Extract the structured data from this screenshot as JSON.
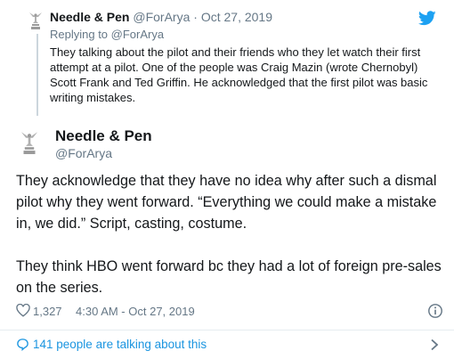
{
  "parent_tweet": {
    "display_name": "Needle & Pen",
    "handle": "@ForArya",
    "separator": "·",
    "date": "Oct 27, 2019",
    "replying_prefix": "Replying to",
    "replying_handle": "@ForArya",
    "text": "They talking about the pilot and their friends who they let  watch their first attempt at a pilot. One of the people was Craig Mazin (wrote Chernobyl) Scott Frank and Ted Griffin. He acknowledged that the first pilot was basic writing mistakes."
  },
  "main_tweet": {
    "display_name": "Needle & Pen",
    "handle": "@ForArya",
    "paragraphs": [
      "They acknowledge that they have no idea why after such a dismal pilot why they went forward. “Everything we could make a mistake in, we did.” Script, casting, costume.",
      "They think HBO went forward bc they had a lot of foreign pre-sales on the series."
    ],
    "like_count": "1,327",
    "timestamp": "4:30 AM - Oct 27, 2019"
  },
  "footer": {
    "talking_text": "141 people are talking about this"
  },
  "icons": {
    "avatar": "emmy-statuette-icon",
    "brand": "twitter-bird-icon",
    "like": "heart-icon",
    "info": "info-icon",
    "conversation": "speech-bubble-icon",
    "arrow": "chevron-right-icon"
  },
  "colors": {
    "accent": "#1da1f2",
    "link": "#1b95e0",
    "muted": "#657786",
    "text": "#14171a",
    "divider": "#e6ecf0"
  }
}
